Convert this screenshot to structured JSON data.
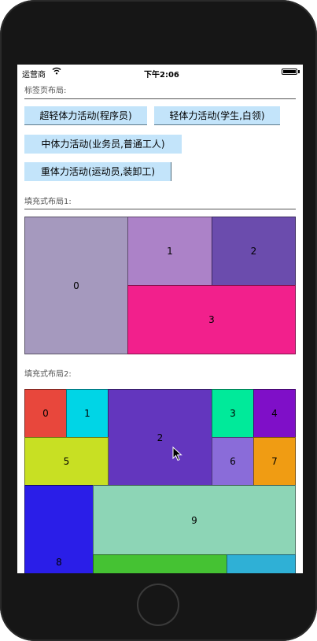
{
  "status": {
    "carrier": "运营商",
    "time": "下午2:06"
  },
  "sections": {
    "tag_label": "标签页布局:",
    "fill1_label": "填充式布局1:",
    "fill2_label": "填充式布局2:"
  },
  "tags": [
    "超轻体力活动(程序员)",
    "轻体力活动(学生,白领)",
    "中体力活动(业务员,普通工人)",
    "重体力活动(运动员,装卸工)"
  ],
  "fill1": {
    "cells": [
      {
        "label": "0",
        "color": "#a599be"
      },
      {
        "label": "1",
        "color": "#ac82c8"
      },
      {
        "label": "2",
        "color": "#6b4cad"
      },
      {
        "label": "3",
        "color": "#f2208c"
      }
    ]
  },
  "fill2": {
    "cells": [
      {
        "label": "0",
        "color": "#e8473c"
      },
      {
        "label": "1",
        "color": "#00d5e6"
      },
      {
        "label": "2",
        "color": "#6336be"
      },
      {
        "label": "3",
        "color": "#00ea9a"
      },
      {
        "label": "4",
        "color": "#7f0fc8"
      },
      {
        "label": "5",
        "color": "#c8e023"
      },
      {
        "label": "6",
        "color": "#8a6cd9"
      },
      {
        "label": "7",
        "color": "#f09c13"
      },
      {
        "label": "8",
        "color": "#2a1ee8"
      },
      {
        "label": "9",
        "color": "#8dd5b6"
      },
      {
        "label": "",
        "color": "#45c233"
      },
      {
        "label": "",
        "color": "#2fb0d6"
      }
    ]
  }
}
